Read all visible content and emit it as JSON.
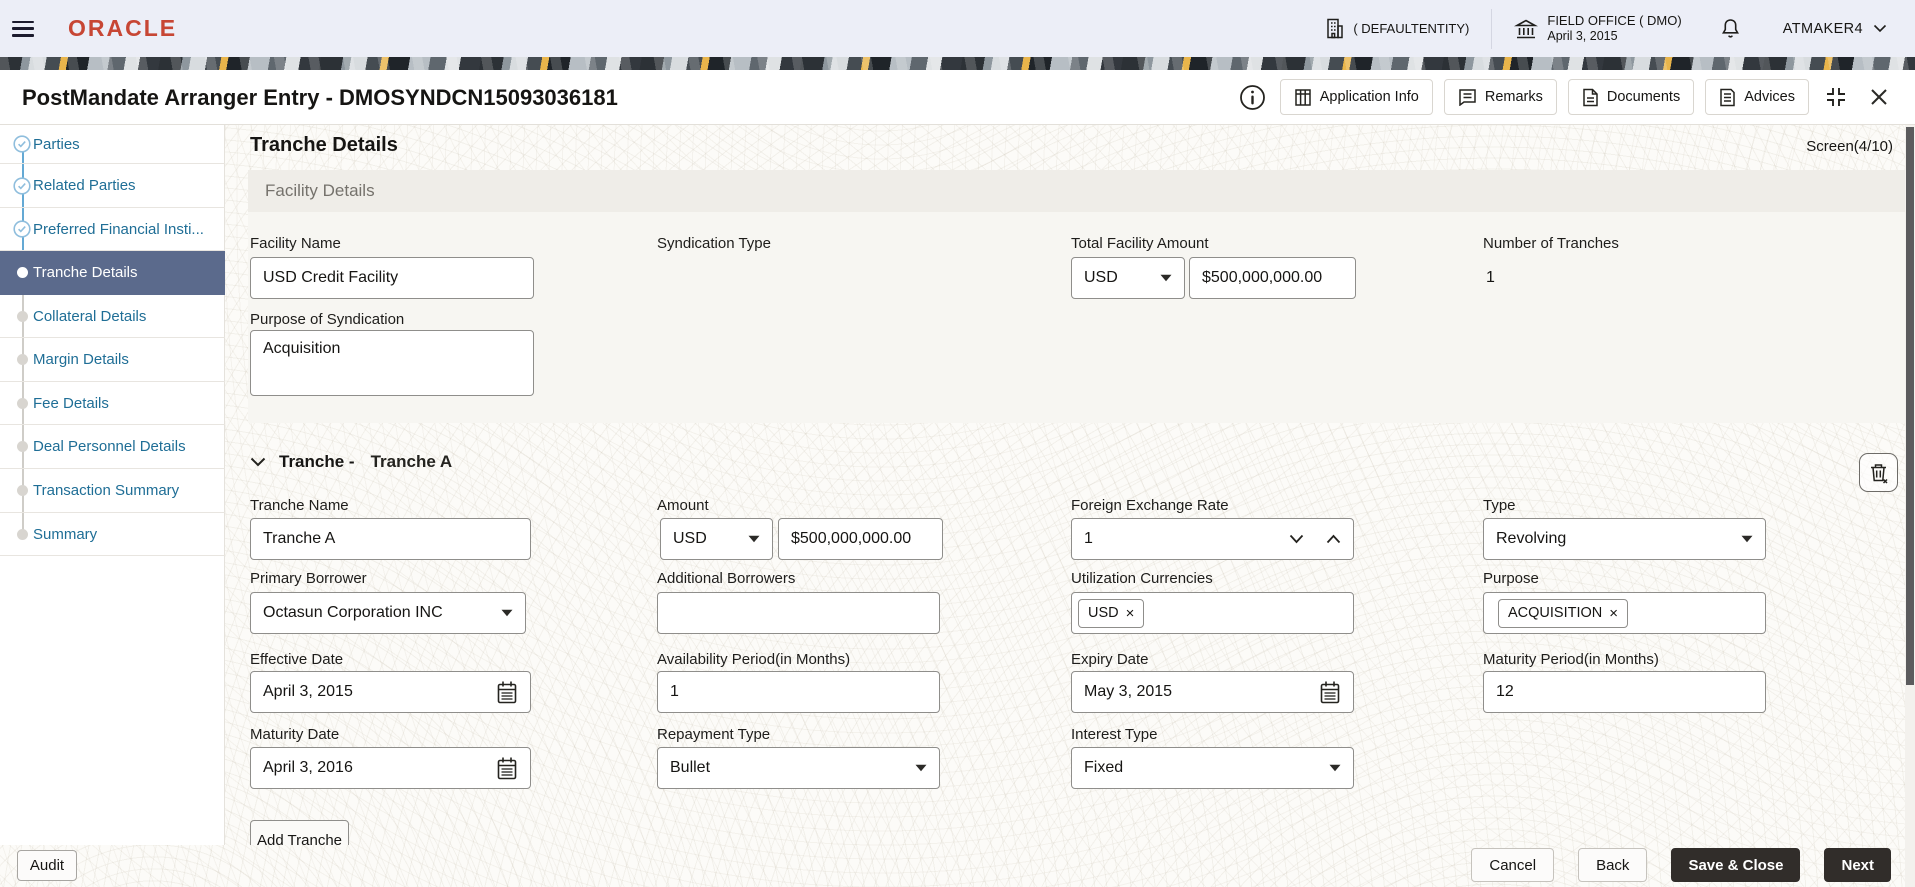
{
  "colors": {
    "oracle_red": "#C74634",
    "active_step_bg": "#5B6A8C",
    "step_link_blue": "#1F6E96",
    "dark_button": "#312D2A"
  },
  "icons": {
    "remove_glyph": "×"
  },
  "header": {
    "brand": "ORACLE",
    "entity": "( DEFAULTENTITY)",
    "branch_name": "FIELD OFFICE ( DMO)",
    "branch_date": "April 3, 2015",
    "user": "ATMAKER4"
  },
  "titlebar": {
    "title": "PostMandate Arranger Entry - DMOSYNDCN15093036181",
    "buttons": {
      "application_info": "Application Info",
      "remarks": "Remarks",
      "documents": "Documents",
      "advices": "Advices"
    }
  },
  "sidebar": {
    "items": [
      {
        "label": "Parties",
        "state": "completed"
      },
      {
        "label": "Related Parties",
        "state": "completed"
      },
      {
        "label": "Preferred Financial Insti...",
        "state": "completed"
      },
      {
        "label": "Tranche Details",
        "state": "active"
      },
      {
        "label": "Collateral Details",
        "state": "upcoming"
      },
      {
        "label": "Margin Details",
        "state": "upcoming"
      },
      {
        "label": "Fee Details",
        "state": "upcoming"
      },
      {
        "label": "Deal Personnel Details",
        "state": "upcoming"
      },
      {
        "label": "Transaction Summary",
        "state": "upcoming"
      },
      {
        "label": "Summary",
        "state": "upcoming"
      }
    ]
  },
  "main": {
    "heading": "Tranche Details",
    "screen_indicator": "Screen(4/10)",
    "facility": {
      "section_title": "Facility Details",
      "facility_name": {
        "label": "Facility Name",
        "value": "USD Credit Facility"
      },
      "syndication_type": {
        "label": "Syndication Type"
      },
      "total_facility_amount": {
        "label": "Total Facility Amount",
        "currency": "USD",
        "value": "$500,000,000.00"
      },
      "number_of_tranches": {
        "label": "Number of Tranches",
        "value": "1"
      },
      "purpose_of_syndication": {
        "label": "Purpose of Syndication",
        "value": "Acquisition"
      }
    },
    "tranche": {
      "collapse_title": "Tranche -",
      "tranche_title": "Tranche A",
      "tranche_name": {
        "label": "Tranche Name",
        "value": "Tranche A"
      },
      "amount": {
        "label": "Amount",
        "currency": "USD",
        "value": "$500,000,000.00"
      },
      "fx_rate": {
        "label": "Foreign Exchange Rate",
        "value": "1"
      },
      "type": {
        "label": "Type",
        "value": "Revolving"
      },
      "primary_borrower": {
        "label": "Primary Borrower",
        "value": "Octasun Corporation INC"
      },
      "additional_borrowers": {
        "label": "Additional Borrowers",
        "value": ""
      },
      "utilization_currencies": {
        "label": "Utilization Currencies",
        "chip": "USD"
      },
      "purpose": {
        "label": "Purpose",
        "chip": "ACQUISITION"
      },
      "effective_date": {
        "label": "Effective Date",
        "value": "April 3, 2015"
      },
      "availability_period": {
        "label": "Availability Period(in Months)",
        "value": "1"
      },
      "expiry_date": {
        "label": "Expiry Date",
        "value": "May 3, 2015"
      },
      "maturity_period": {
        "label": "Maturity Period(in Months)",
        "value": "12"
      },
      "maturity_date": {
        "label": "Maturity Date",
        "value": "April 3, 2016"
      },
      "repayment_type": {
        "label": "Repayment Type",
        "value": "Bullet"
      },
      "interest_type": {
        "label": "Interest Type",
        "value": "Fixed"
      },
      "add_button": "Add Tranche"
    }
  },
  "footer": {
    "audit": "Audit",
    "cancel": "Cancel",
    "back": "Back",
    "save_close": "Save & Close",
    "next": "Next"
  }
}
